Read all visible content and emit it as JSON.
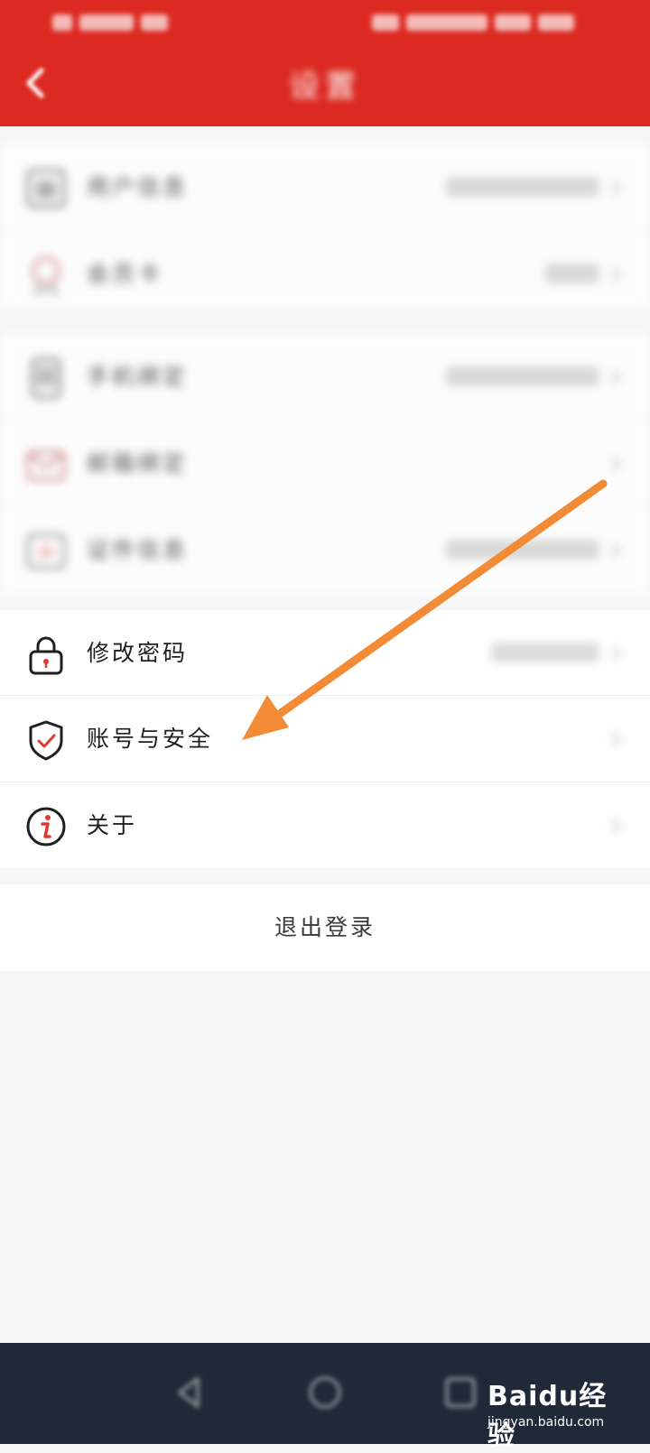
{
  "header": {
    "title": "设置"
  },
  "settings": {
    "groups": [
      {
        "items": [
          {
            "label": "用户信息",
            "value": ""
          },
          {
            "label": "会员卡",
            "value": ""
          }
        ]
      },
      {
        "items": [
          {
            "label": "手机绑定",
            "value": ""
          },
          {
            "label": "邮箱绑定",
            "value": ""
          },
          {
            "label": "证件信息",
            "value": ""
          }
        ]
      },
      {
        "items": [
          {
            "label": "修改密码",
            "icon": "lock-icon"
          },
          {
            "label": "账号与安全",
            "icon": "shield-check-icon"
          },
          {
            "label": "关于",
            "icon": "info-icon"
          }
        ]
      }
    ]
  },
  "logout": {
    "label": "退出登录"
  },
  "watermark": {
    "brand": "Baidu经验",
    "url": "jingyan.baidu.com"
  },
  "colors": {
    "header_bg": "#dc2a22",
    "arrow": "#f28a36",
    "accent_red": "#e03a30"
  }
}
